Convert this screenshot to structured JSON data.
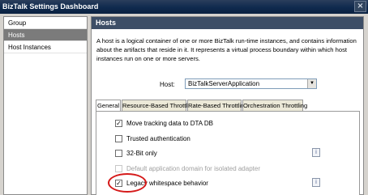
{
  "window": {
    "title": "BizTalk Settings Dashboard",
    "close_glyph": "×"
  },
  "sidebar": {
    "items": [
      {
        "label": "Group",
        "selected": false
      },
      {
        "label": "Hosts",
        "selected": true
      },
      {
        "label": "Host Instances",
        "selected": false
      }
    ]
  },
  "panel": {
    "title": "Hosts",
    "description": "A host is a logical container of one or more BizTalk run-time instances, and contains information about the artifacts that reside in it. It represents a virtual process boundary within which host instances run on one or more servers.",
    "host_label": "Host:",
    "host_value": "BizTalkServerApplication",
    "dropdown_glyph": "▼"
  },
  "tabs": [
    {
      "label": "General",
      "active": true
    },
    {
      "label": "Resource-Based Throttling",
      "active": false
    },
    {
      "label": "Rate-Based Throttling",
      "active": false
    },
    {
      "label": "Orchestration Throttling",
      "active": false
    }
  ],
  "options": [
    {
      "label": "Move tracking data to DTA DB",
      "checked": true,
      "enabled": true
    },
    {
      "label": "Trusted authentication",
      "checked": false,
      "enabled": true
    },
    {
      "label": "32-Bit only",
      "checked": false,
      "enabled": true
    },
    {
      "label": "Default application domain for isolated adapter",
      "checked": false,
      "enabled": false
    },
    {
      "label": "Legacy whitespace behavior",
      "checked": true,
      "enabled": true
    }
  ],
  "check_glyph": "✓",
  "info_glyph": "i",
  "annotation_color": "#d51a1a"
}
